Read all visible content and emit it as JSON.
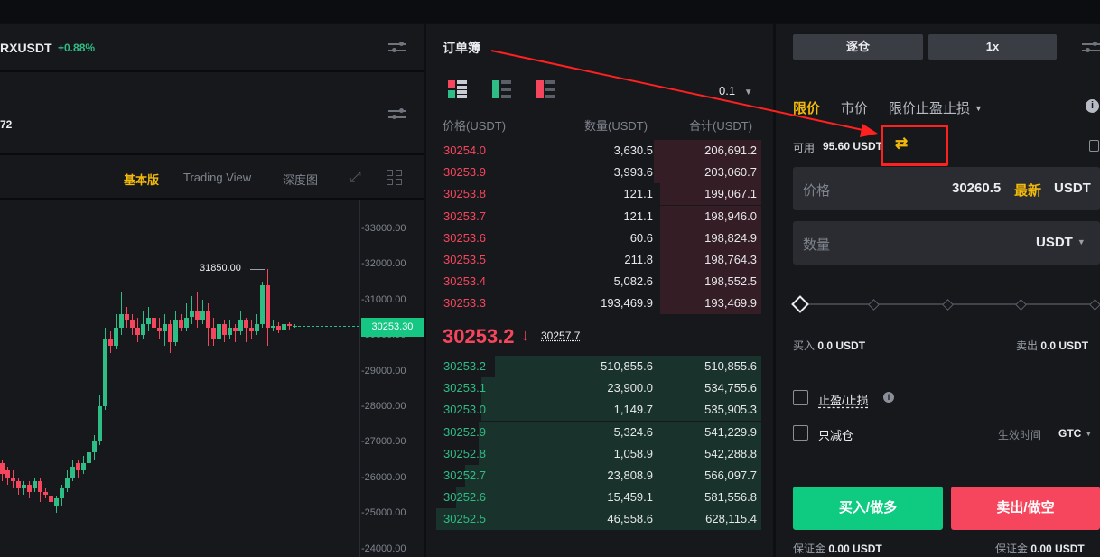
{
  "symbol": {
    "name": "RXUSDT",
    "change": "+0.88%",
    "stat_fragment": "72"
  },
  "chart_tabs": {
    "basic": "基本版",
    "tradingview": "Trading View",
    "depth": "深度图"
  },
  "chart": {
    "price_ticks": [
      "33000.00",
      "32000.00",
      "31000.00",
      "30000.00",
      "29000.00",
      "28000.00",
      "27000.00",
      "26000.00",
      "25000.00",
      "24000.00"
    ],
    "high_label": "31850.00",
    "last_price_tag": "30253.30",
    "colors": {
      "up": "#2ebd85",
      "down": "#f6465d",
      "tag_bg": "#16c784"
    }
  },
  "orderbook": {
    "title": "订单簿",
    "precision": "0.1",
    "headers": {
      "price": "价格(USDT)",
      "qty": "数量(USDT)",
      "total": "合计(USDT)"
    },
    "asks": [
      {
        "price": "30254.0",
        "qty": "3,630.5",
        "total": "206,691.2",
        "depth": 0.33
      },
      {
        "price": "30253.9",
        "qty": "3,993.6",
        "total": "203,060.7",
        "depth": 0.33
      },
      {
        "price": "30253.8",
        "qty": "121.1",
        "total": "199,067.1",
        "depth": 0.31
      },
      {
        "price": "30253.7",
        "qty": "121.1",
        "total": "198,946.0",
        "depth": 0.31
      },
      {
        "price": "30253.6",
        "qty": "60.6",
        "total": "198,824.9",
        "depth": 0.31
      },
      {
        "price": "30253.5",
        "qty": "211.8",
        "total": "198,764.3",
        "depth": 0.31
      },
      {
        "price": "30253.4",
        "qty": "5,082.6",
        "total": "198,552.5",
        "depth": 0.31
      },
      {
        "price": "30253.3",
        "qty": "193,469.9",
        "total": "193,469.9",
        "depth": 0.31
      }
    ],
    "last_price": "30253.2",
    "last_arrow": "↓",
    "mark_price": "30257.7",
    "bids": [
      {
        "price": "30253.2",
        "qty": "510,855.6",
        "total": "510,855.6",
        "depth": 0.82
      },
      {
        "price": "30253.1",
        "qty": "23,900.0",
        "total": "534,755.6",
        "depth": 0.86
      },
      {
        "price": "30253.0",
        "qty": "1,149.7",
        "total": "535,905.3",
        "depth": 0.86
      },
      {
        "price": "30252.9",
        "qty": "5,324.6",
        "total": "541,229.9",
        "depth": 0.87
      },
      {
        "price": "30252.8",
        "qty": "1,058.9",
        "total": "542,288.8",
        "depth": 0.87
      },
      {
        "price": "30252.7",
        "qty": "23,808.9",
        "total": "566,097.7",
        "depth": 0.91
      },
      {
        "price": "30252.6",
        "qty": "15,459.1",
        "total": "581,556.8",
        "depth": 0.94
      },
      {
        "price": "30252.5",
        "qty": "46,558.6",
        "total": "628,115.4",
        "depth": 1.0
      }
    ]
  },
  "trade": {
    "margin_mode": "逐仓",
    "leverage": "1x",
    "order_types": {
      "limit": "限价",
      "market": "市价",
      "stop_limit": "限价止盈止损"
    },
    "available_label": "可用",
    "available_value": "95.60 USDT",
    "price_label": "价格",
    "price_value": "30260.5",
    "latest_label": "最新",
    "price_unit": "USDT",
    "qty_label": "数量",
    "qty_unit": "USDT",
    "slider_percent": 0,
    "buy_amount_label": "买入",
    "buy_amount_value": "0.0 USDT",
    "sell_amount_label": "卖出",
    "sell_amount_value": "0.0 USDT",
    "tp_sl_label": "止盈/止损",
    "reduce_only_label": "只减仓",
    "tif_label": "生效时间",
    "tif_value": "GTC",
    "buy_button": "买入/做多",
    "sell_button": "卖出/做空",
    "buy_margin_label": "保证金",
    "buy_margin_value": "0.00 USDT",
    "sell_margin_label": "保证金",
    "sell_margin_value": "0.00 USDT",
    "colors": {
      "buy": "#0ecb81",
      "sell": "#f6465d",
      "accent": "#f0b90b"
    }
  },
  "annotation": {
    "color": "#ff2020"
  }
}
